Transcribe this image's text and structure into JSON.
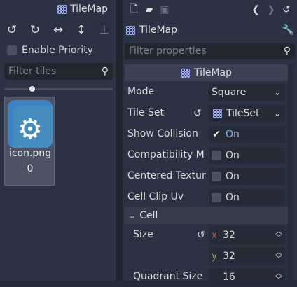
{
  "left_panel": {
    "title": "TileMap",
    "enable_priority_label": "Enable Priority",
    "filter_placeholder": "Filter tiles",
    "tools": [
      "rotate-left-icon",
      "rotate-right-icon",
      "flip-horizontal-icon",
      "flip-vertical-icon",
      "clear-transform-icon"
    ],
    "tile": {
      "name": "icon.png",
      "index": "0"
    }
  },
  "right_panel": {
    "header_title": "TileMap",
    "filter_placeholder": "Filter properties",
    "section_title": "TileMap",
    "properties": {
      "mode": {
        "label": "Mode",
        "value": "Square"
      },
      "tile_set": {
        "label": "Tile Set",
        "value": "TileSet"
      },
      "show_collision": {
        "label": "Show Collision",
        "value": "On",
        "checked": true
      },
      "compatibility_mode": {
        "label": "Compatibility M",
        "value": "On",
        "checked": false
      },
      "centered_textures": {
        "label": "Centered Textur",
        "value": "On",
        "checked": false
      },
      "cell_clip_uv": {
        "label": "Cell Clip Uv",
        "value": "On",
        "checked": false
      }
    },
    "cell": {
      "label": "Cell",
      "size_label": "Size",
      "size_x_axis": "x",
      "size_x": "32",
      "size_y_axis": "y",
      "size_y": "32",
      "quadrant_label": "Quadrant Size",
      "quadrant_value": "16"
    }
  },
  "colors": {
    "panel_bg": "#2b3243",
    "field_bg": "#262b37",
    "accent_on": "#8fb3e0",
    "axis_x": "#c1665a",
    "axis_y": "#7eb861"
  }
}
